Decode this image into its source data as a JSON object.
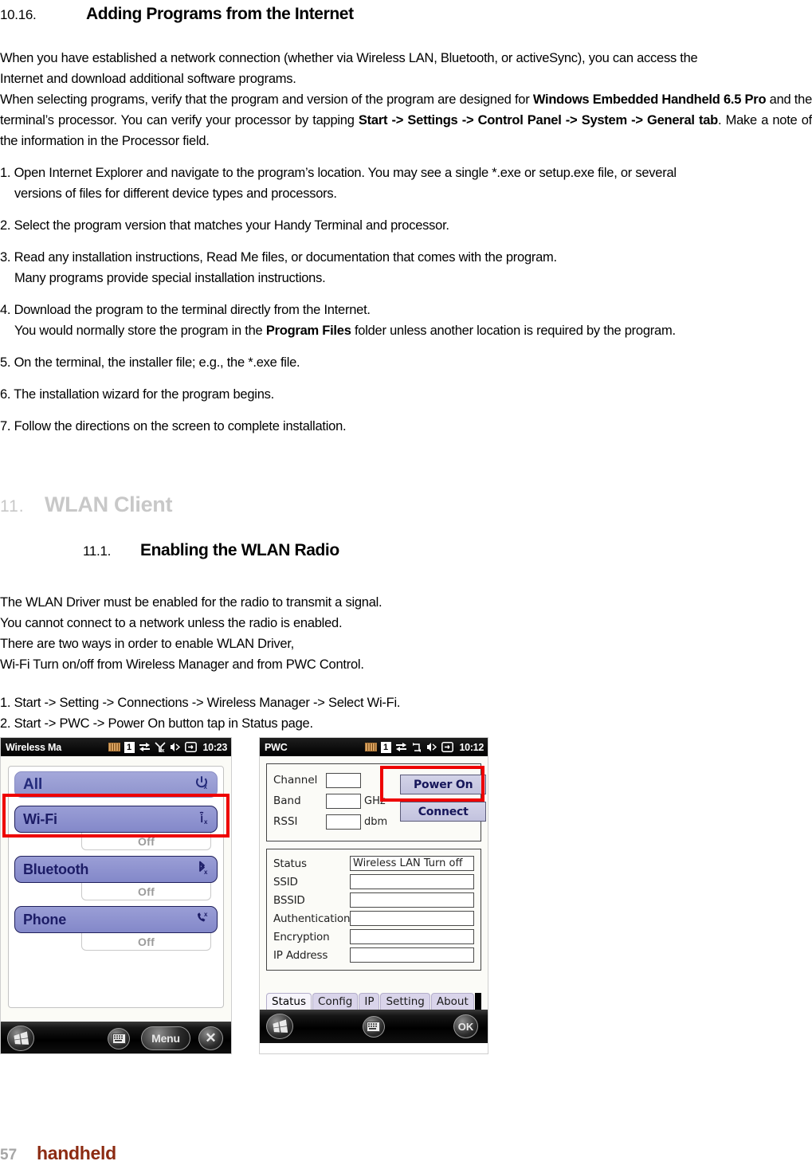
{
  "doc": {
    "section_10_16": {
      "number": "10.16.",
      "title": "Adding Programs from the Internet",
      "intro_line1": "When you have established a network connection (whether via Wireless LAN, Bluetooth, or activeSync), you can access the",
      "intro_line2": "Internet and download additional software programs.",
      "para2_a": "When selecting programs, verify that the program and version of the program are designed for ",
      "para2_b": "Windows Embedded Handheld 6.5 Pro",
      "para2_c": " and the terminal’s processor. You can verify your processor by tapping ",
      "para2_d": "Start -> Settings -> Control Panel -> System -> General tab",
      "para2_e": ". Make a note of the information in the Processor field.",
      "steps": [
        {
          "text": "1. Open Internet Explorer and navigate to the program’s location. You may see a single *.exe or setup.exe file, or several",
          "cont": "versions of files for different device types and processors."
        },
        {
          "text": "2. Select the program version that matches your Handy Terminal and processor.",
          "cont": ""
        },
        {
          "text": "3. Read any installation instructions, Read Me files, or documentation that comes with the program.",
          "cont": "Many programs provide special installation instructions."
        },
        {
          "text": "4. Download the program to the terminal directly from the Internet.",
          "cont_a": "You would normally store the program in the ",
          "cont_b": "Program Files",
          "cont_c": " folder unless another location is required by the program."
        },
        {
          "text": "5. On the terminal, the installer file; e.g., the *.exe file.",
          "cont": ""
        },
        {
          "text": "6. The installation wizard for the program begins.",
          "cont": ""
        },
        {
          "text": "7. Follow the directions on the screen to complete installation.",
          "cont": ""
        }
      ]
    },
    "chapter_11": {
      "number": "11.",
      "title": "WLAN Client",
      "color": "#c8c8c8"
    },
    "section_11_1": {
      "number": "11.1.",
      "title": "Enabling the WLAN Radio",
      "lines": [
        "The WLAN Driver must be enabled for the radio to transmit a signal.",
        "You cannot connect to a network unless the radio is enabled.",
        "There are two ways in order to enable WLAN Driver,",
        "Wi-Fi Turn on/off from Wireless Manager and from PWC Control."
      ],
      "numbered": [
        "1. Start -> Setting -> Connections -> Wireless Manager -> Select Wi-Fi.",
        "2. Start -> PWC -> Power On button tap in Status page."
      ]
    },
    "footer": {
      "page": "57",
      "brand": "handheld"
    }
  },
  "screenshot_wireless_manager": {
    "titlebar": {
      "app_name": "Wireless Ma",
      "clock": "10:23",
      "icons": [
        "battery-icon",
        "one-badge-icon",
        "data-transfer-icon",
        "signal-off-icon",
        "speaker-icon",
        "sync-icon"
      ]
    },
    "rows": [
      {
        "label": "All",
        "glyph": "⏻",
        "glyph_name": "power-off-icon",
        "state": ""
      },
      {
        "label": "Wi-Fi",
        "glyph": "὏6",
        "glyph_name": "wifi-off-icon",
        "state": "Off",
        "highlighted": true
      },
      {
        "label": "Bluetooth",
        "glyph": "B",
        "glyph_name": "bluetooth-off-icon",
        "state": "Off"
      },
      {
        "label": "Phone",
        "glyph": "✆",
        "glyph_name": "phone-off-icon",
        "state": "Off"
      }
    ],
    "softkeys": [
      {
        "name": "start-button",
        "label": ""
      },
      {
        "name": "keyboard-button",
        "label": ""
      },
      {
        "name": "menu-button",
        "label": "Menu"
      },
      {
        "name": "close-button",
        "label": "✕"
      }
    ],
    "highlight_color": "#ee0000"
  },
  "screenshot_pwc": {
    "titlebar": {
      "app_name": "PWC",
      "clock": "10:12",
      "icons": [
        "battery-icon",
        "one-badge-icon",
        "data-transfer-icon",
        "rotate-icon",
        "speaker-icon",
        "sync-icon"
      ]
    },
    "radio_fields": [
      {
        "label": "Channel",
        "value": "",
        "unit": ""
      },
      {
        "label": "Band",
        "value": "",
        "unit": "GHz"
      },
      {
        "label": "RSSI",
        "value": "",
        "unit": "dbm"
      }
    ],
    "buttons": [
      {
        "label": "Power On",
        "highlighted": true
      },
      {
        "label": "Connect",
        "highlighted": false
      }
    ],
    "status_fields": [
      {
        "label": "Status",
        "value": "Wireless LAN Turn off"
      },
      {
        "label": "SSID",
        "value": ""
      },
      {
        "label": "BSSID",
        "value": ""
      },
      {
        "label": "Authentication",
        "value": ""
      },
      {
        "label": "Encryption",
        "value": ""
      },
      {
        "label": "IP Address",
        "value": ""
      }
    ],
    "tabs": [
      {
        "label": "Status",
        "active": true
      },
      {
        "label": "Config",
        "active": false
      },
      {
        "label": "IP",
        "active": false
      },
      {
        "label": "Setting",
        "active": false
      },
      {
        "label": "About",
        "active": false
      }
    ],
    "softkeys": [
      {
        "name": "start-button",
        "label": ""
      },
      {
        "name": "keyboard-button",
        "label": ""
      },
      {
        "name": "ok-button",
        "label": "OK"
      }
    ],
    "highlight_color": "#ee0000"
  }
}
